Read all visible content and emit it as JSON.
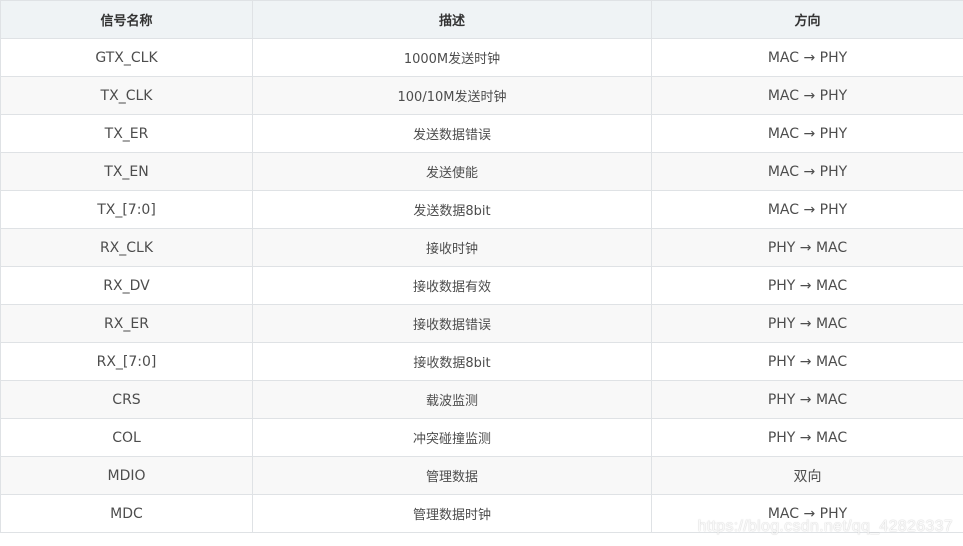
{
  "table": {
    "headers": [
      "信号名称",
      "描述",
      "方向"
    ],
    "rows": [
      {
        "name": "GTX_CLK",
        "desc": "1000M发送时钟",
        "dir": "MAC → PHY"
      },
      {
        "name": "TX_CLK",
        "desc": "100/10M发送时钟",
        "dir": "MAC → PHY"
      },
      {
        "name": "TX_ER",
        "desc": "发送数据错误",
        "dir": "MAC → PHY"
      },
      {
        "name": "TX_EN",
        "desc": "发送使能",
        "dir": "MAC → PHY"
      },
      {
        "name": "TX_[7:0]",
        "desc": "发送数据8bit",
        "dir": "MAC → PHY"
      },
      {
        "name": "RX_CLK",
        "desc": "接收时钟",
        "dir": "PHY → MAC"
      },
      {
        "name": "RX_DV",
        "desc": "接收数据有效",
        "dir": "PHY → MAC"
      },
      {
        "name": "RX_ER",
        "desc": "接收数据错误",
        "dir": "PHY → MAC"
      },
      {
        "name": "RX_[7:0]",
        "desc": "接收数据8bit",
        "dir": "PHY → MAC"
      },
      {
        "name": "CRS",
        "desc": "载波监测",
        "dir": "PHY → MAC"
      },
      {
        "name": "COL",
        "desc": "冲突碰撞监测",
        "dir": "PHY → MAC"
      },
      {
        "name": "MDIO",
        "desc": "管理数据",
        "dir": "双向"
      },
      {
        "name": "MDC",
        "desc": "管理数据时钟",
        "dir": "MAC → PHY"
      }
    ]
  },
  "watermark": "https://blog.csdn.net/qq_42826337"
}
